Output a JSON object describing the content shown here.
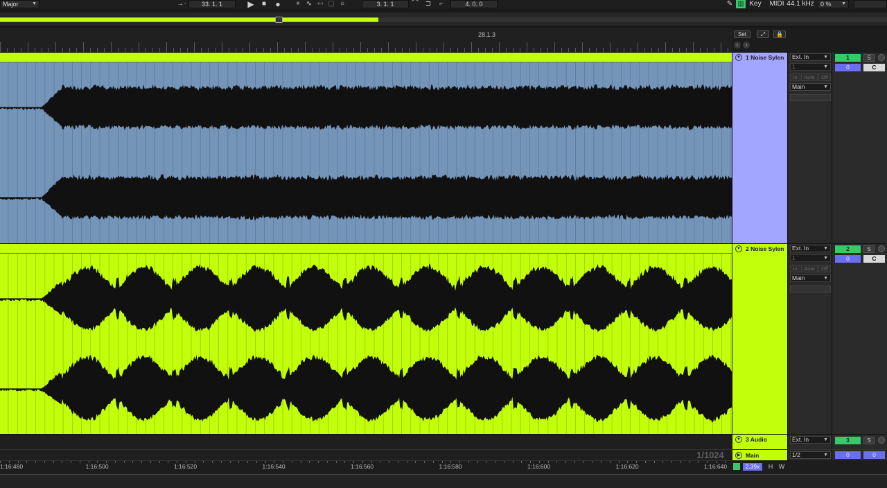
{
  "transport": {
    "scale": "Major",
    "position": "33.  1.  1",
    "loop_start": "3.  1.  1",
    "loop_length": "4.  0.  0",
    "icons": [
      "metronome-icon",
      "play-icon",
      "stop-icon",
      "record-icon",
      "overdub-icon",
      "automation-arm-icon",
      "back-to-arrangement-icon",
      "session-record-icon",
      "loop-icon",
      "punch-in-icon",
      "punch-out-icon"
    ]
  },
  "status": {
    "key": "Key",
    "midi": "MIDI",
    "sample_rate": "44.1 kHz",
    "cpu": "0 %"
  },
  "ruler": {
    "beat_marker": "28.1.3",
    "set_label": "Set"
  },
  "tracks": [
    {
      "name": "1 Noise Sylen",
      "input": "Ext. In",
      "channel": "1",
      "monitor": [
        "In",
        "Auto",
        "Off"
      ],
      "output": "Main",
      "number": "1",
      "volume": "0",
      "solo": "S",
      "pan": "C",
      "color": "#a3a6ff"
    },
    {
      "name": "2 Noise Sylen",
      "input": "Ext. In",
      "channel": "1",
      "monitor": [
        "In",
        "Auto",
        "Off"
      ],
      "output": "Main",
      "number": "2",
      "volume": "0",
      "solo": "S",
      "pan": "C",
      "color": "#c1ff0a"
    },
    {
      "name": "3 Audio",
      "input": "Ext. In",
      "number": "3",
      "solo": "S",
      "color": "#c1ff0a"
    }
  ],
  "main_track": {
    "name": "Main",
    "output": "1/2",
    "volume_left": "0",
    "volume_right": "0"
  },
  "time_ruler": {
    "labels": [
      "1:16:480",
      "1:16:500",
      "1:16:520",
      "1:16:540",
      "1:16:560",
      "1:16:580",
      "1:16:600",
      "1:16:620",
      "1:16:640"
    ],
    "zoom": "1/1024"
  },
  "bottom": {
    "zoom_factor": "2.39x",
    "h_label": "H",
    "w_label": "W"
  },
  "colors": {
    "accent_lime": "#c1ff0a",
    "clip_blue": "#7494b8",
    "track_lavender": "#a3a6ff",
    "arm_green": "#38c968",
    "volume_blue": "#6a6ff0"
  }
}
